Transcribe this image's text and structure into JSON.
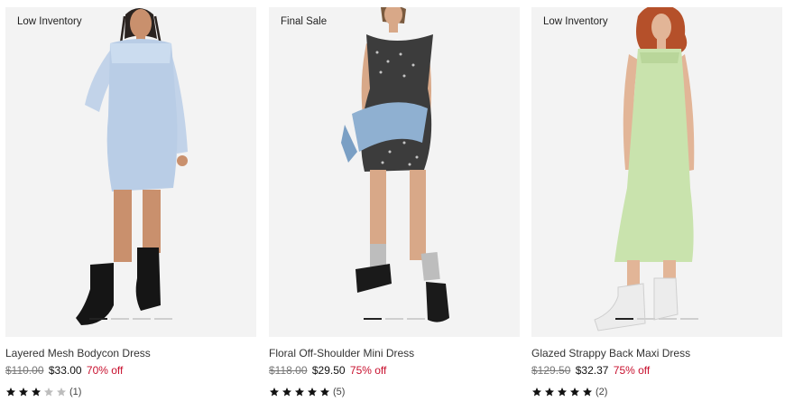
{
  "products": [
    {
      "badge": "Low Inventory",
      "title": "Layered Mesh Bodycon Dress",
      "original_price": "$110.00",
      "sale_price": "$33.00",
      "discount": "70% off",
      "rating": 3,
      "review_count": "(1)",
      "dress_color": "#b9cde6",
      "image_dots": 4,
      "active_dot": 1
    },
    {
      "badge": "Final Sale",
      "title": "Floral Off-Shoulder Mini Dress",
      "original_price": "$118.00",
      "sale_price": "$29.50",
      "discount": "75% off",
      "rating": 5,
      "review_count": "(5)",
      "dress_color": "#3c3c3c",
      "image_dots": 3,
      "active_dot": 1
    },
    {
      "badge": "Low Inventory",
      "title": "Glazed Strappy Back Maxi Dress",
      "original_price": "$129.50",
      "sale_price": "$32.37",
      "discount": "75% off",
      "rating": 5,
      "review_count": "(2)",
      "dress_color": "#c9e3ad",
      "image_dots": 4,
      "active_dot": 1
    }
  ],
  "colors": {
    "discount": "#c8102e",
    "star_filled": "#111111",
    "star_empty": "#bdbdbd",
    "image_bg": "#f3f3f3"
  }
}
